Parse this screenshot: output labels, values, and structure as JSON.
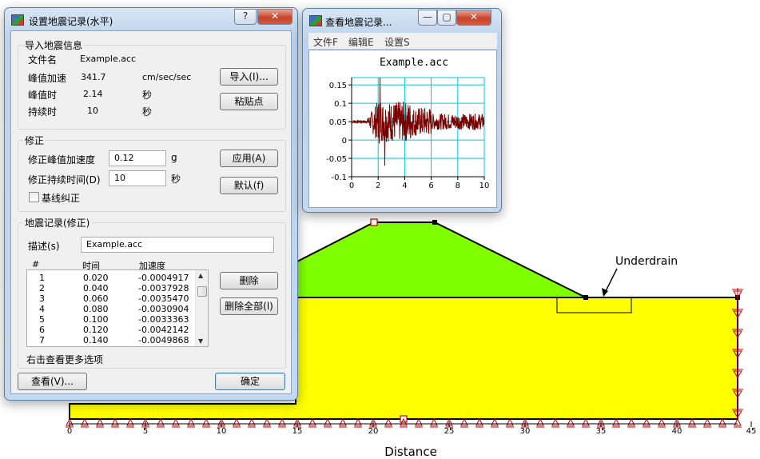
{
  "model": {
    "xlabel": "Distance",
    "x_ticks": [
      "0",
      "5",
      "10",
      "15",
      "20",
      "25",
      "30",
      "35",
      "40",
      "45"
    ],
    "underdrain_label": "Underdrain",
    "colors": {
      "embankment": "#80ff00",
      "foundation": "#ffff00",
      "boundary": "#c00000"
    }
  },
  "dialog": {
    "title": "设置地震记录(水平)",
    "help_btn": "?",
    "close_btn": "✕",
    "import_group": {
      "title": "导入地震信息",
      "file_label": "文件名",
      "file_value": "Example.acc",
      "peak_acc_label": "峰值加速",
      "peak_acc_value": "341.7",
      "peak_acc_unit": "cm/sec/sec",
      "peak_time_label": "峰值时",
      "peak_time_value": "2.14",
      "peak_time_unit": "秒",
      "duration_label": "持续时",
      "duration_value": "10",
      "duration_unit": "秒",
      "import_button": "导入(I)...",
      "paste_button": "粘贴点"
    },
    "correct_group": {
      "title": "修正",
      "peak_label": "修正峰值加速度",
      "peak_value": "0.12",
      "peak_unit": "g",
      "duration_label": "修正持续时间(D)",
      "duration_value": "10",
      "duration_unit": "秒",
      "baseline_label": "基线纠正",
      "apply_button": "应用(A)",
      "default_button": "默认(f)"
    },
    "record_group": {
      "title": "地震记录(修正)",
      "desc_label": "描述(s)",
      "desc_value": "Example.acc",
      "columns": [
        "#",
        "时间",
        "加速度"
      ],
      "rows": [
        [
          "1",
          "0.020",
          "-0.0004917"
        ],
        [
          "2",
          "0.040",
          "-0.0037928"
        ],
        [
          "3",
          "0.060",
          "-0.0035470"
        ],
        [
          "4",
          "0.080",
          "-0.0030904"
        ],
        [
          "5",
          "0.100",
          "-0.0033363"
        ],
        [
          "6",
          "0.120",
          "-0.0042142"
        ],
        [
          "7",
          "0.140",
          "-0.0049868"
        ]
      ],
      "delete_button": "删除",
      "delete_all_button": "删除全部(l)",
      "hint": "右击查看更多选项"
    },
    "view_button": "查看(V)...",
    "ok_button": "确定"
  },
  "viewer": {
    "title": "查看地震记录...",
    "min_btn": "—",
    "max_btn": "▢",
    "close_btn": "✕",
    "menu": [
      "文件F",
      "编辑E",
      "设置S"
    ],
    "chart_data": {
      "type": "line",
      "title": "Example.acc",
      "x_ticks": [
        "0",
        "2",
        "4",
        "6",
        "8",
        "10"
      ],
      "y_ticks": [
        "0.15",
        "0.1",
        "0.05",
        "0",
        "-0.05",
        "-0.1"
      ],
      "xlim": [
        0,
        10
      ],
      "ylim": [
        -0.1,
        0.17
      ],
      "grid": true,
      "line_color": "#7a0000",
      "grid_color": "#00c8d8"
    }
  }
}
